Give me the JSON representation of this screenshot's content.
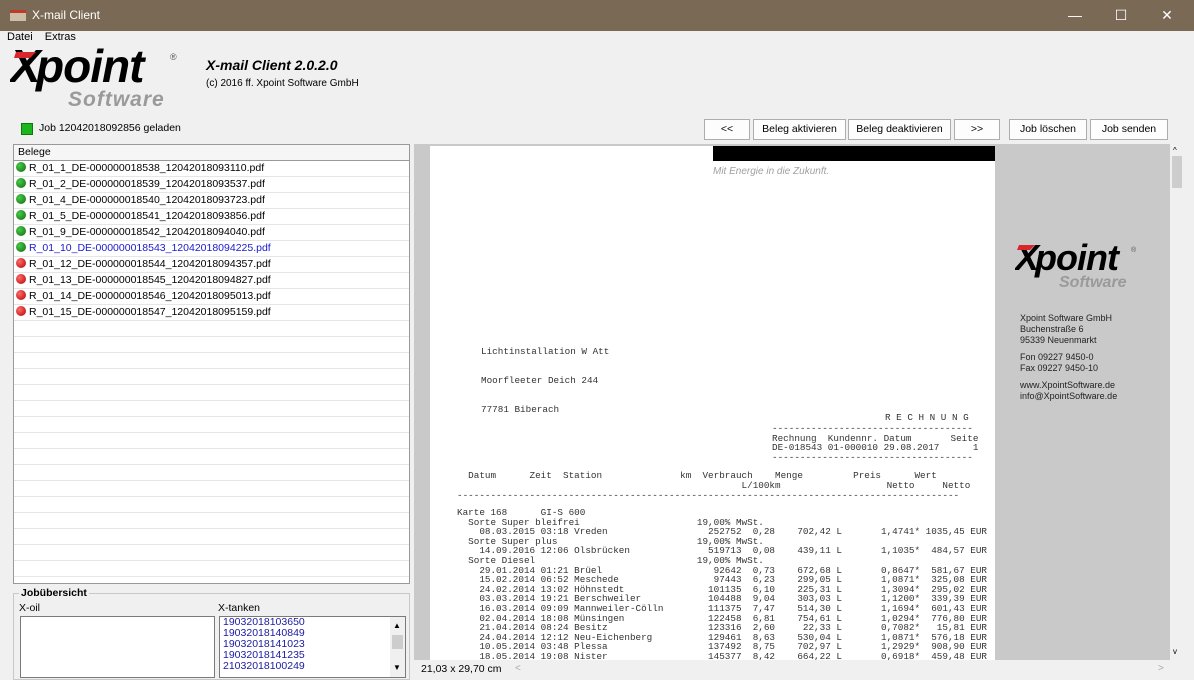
{
  "window": {
    "title": "X-mail Client",
    "minimize": "—",
    "maximize": "☐",
    "close": "✕"
  },
  "menu": [
    "Datei",
    "Extras"
  ],
  "logo": {
    "brand": "Xpoint",
    "sub": "Software",
    "reg": "®"
  },
  "app": {
    "title": "X-mail Client 2.0.2.0",
    "copyright": "(c) 2016 ff. Xpoint Software GmbH"
  },
  "status": {
    "text": "Job 12042018092856 geladen",
    "color": "#1db51d"
  },
  "toolbar": {
    "prev": "<<",
    "activate": "Beleg aktivieren",
    "deactivate": "Beleg deaktivieren",
    "next": ">>",
    "delete_job": "Job löschen",
    "send_job": "Job senden"
  },
  "belege": {
    "header": "Belege",
    "items": [
      {
        "name": "R_01_1_DE-000000018538_12042018093110.pdf",
        "status": "green",
        "selected": false
      },
      {
        "name": "R_01_2_DE-000000018539_12042018093537.pdf",
        "status": "green",
        "selected": false
      },
      {
        "name": "R_01_4_DE-000000018540_12042018093723.pdf",
        "status": "green",
        "selected": false
      },
      {
        "name": "R_01_5_DE-000000018541_12042018093856.pdf",
        "status": "green",
        "selected": false
      },
      {
        "name": "R_01_9_DE-000000018542_12042018094040.pdf",
        "status": "green",
        "selected": false
      },
      {
        "name": "R_01_10_DE-000000018543_12042018094225.pdf",
        "status": "green",
        "selected": true
      },
      {
        "name": "R_01_12_DE-000000018544_12042018094357.pdf",
        "status": "red",
        "selected": false
      },
      {
        "name": "R_01_13_DE-000000018545_12042018094827.pdf",
        "status": "red",
        "selected": false
      },
      {
        "name": "R_01_14_DE-000000018546_12042018095013.pdf",
        "status": "red",
        "selected": false
      },
      {
        "name": "R_01_15_DE-000000018547_12042018095159.pdf",
        "status": "red",
        "selected": false
      }
    ]
  },
  "jobs": {
    "legend": "Jobübersicht",
    "xoil_label": "X-oil",
    "xtanken_label": "X-tanken",
    "xtanken": [
      "19032018103650",
      "19032018140849",
      "19032018141023",
      "19032018141235",
      "21032018100249"
    ]
  },
  "preview": {
    "page_size": "21,03 x 29,70 cm",
    "slogan": "Mit Energie in die Zukunft.",
    "company": {
      "name": "Xpoint Software GmbH",
      "street": "Buchenstraße 6",
      "city": "95339 Neuenmarkt",
      "fon": "Fon 09227 9450-0",
      "fax": "Fax 09227 9450-10",
      "web": "www.XpointSoftware.de",
      "mail": "info@XpointSoftware.de"
    },
    "recipient": [
      "Lichtinstallation W Att",
      "Moorfleeter Deich 244",
      "77781 Biberach"
    ],
    "doc_title": "R E C H N U N G",
    "invoice_block": "------------------------------------\nRechnung  Kundennr. Datum       Seite\nDE-018543 01-000010 29.08.2017      1\n------------------------------------",
    "table_header": "  Datum      Zeit  Station              km  Verbrauch    Menge         Preis      Wert\n                                                   L/100km                   Netto     Netto",
    "divider": "------------------------------------------------------------------------------------------",
    "body_lines": [
      "Karte 168      GI-S 600",
      "  Sorte Super bleifrei                     19,00% MwSt.",
      "    08.03.2015 03:18 Vreden                  252752  0,28    702,42 L       1,4741* 1035,45 EUR",
      "  Sorte Super plus                         19,00% MwSt.",
      "    14.09.2016 12:06 Olsbrücken              519713  0,08    439,11 L       1,1035*  484,57 EUR",
      "  Sorte Diesel                             19,00% MwSt.",
      "    29.01.2014 01:21 Brüel                    92642  0,73    672,68 L       0,8647*  581,67 EUR",
      "    15.02.2014 06:52 Meschede                 97443  6,23    299,05 L       1,0871*  325,08 EUR",
      "    24.02.2014 13:02 Höhnstedt               101135  6,10    225,31 L       1,3094*  295,02 EUR",
      "    03.03.2014 19:21 Berschweiler            104488  9,04    303,03 L       1,1200*  339,39 EUR",
      "    16.03.2014 09:09 Mannweiler-Cölln        111375  7,47    514,30 L       1,1694*  601,43 EUR",
      "    02.04.2014 18:08 Münsingen               122458  6,81    754,61 L       1,0294*  776,80 EUR",
      "    21.04.2014 08:24 Besitz                  123316  2,60     22,33 L       0,7082*   15,81 EUR",
      "    24.04.2014 12:12 Neu-Eichenberg          129461  8,63    530,04 L       1,0871*  576,18 EUR",
      "    10.05.2014 03:48 Plessa                  137492  8,75    702,97 L       1,2929*  908,90 EUR",
      "    18.05.2014 19:08 Nister                  145377  8,42    664,22 L       0,6918*  459,48 EUR"
    ]
  }
}
